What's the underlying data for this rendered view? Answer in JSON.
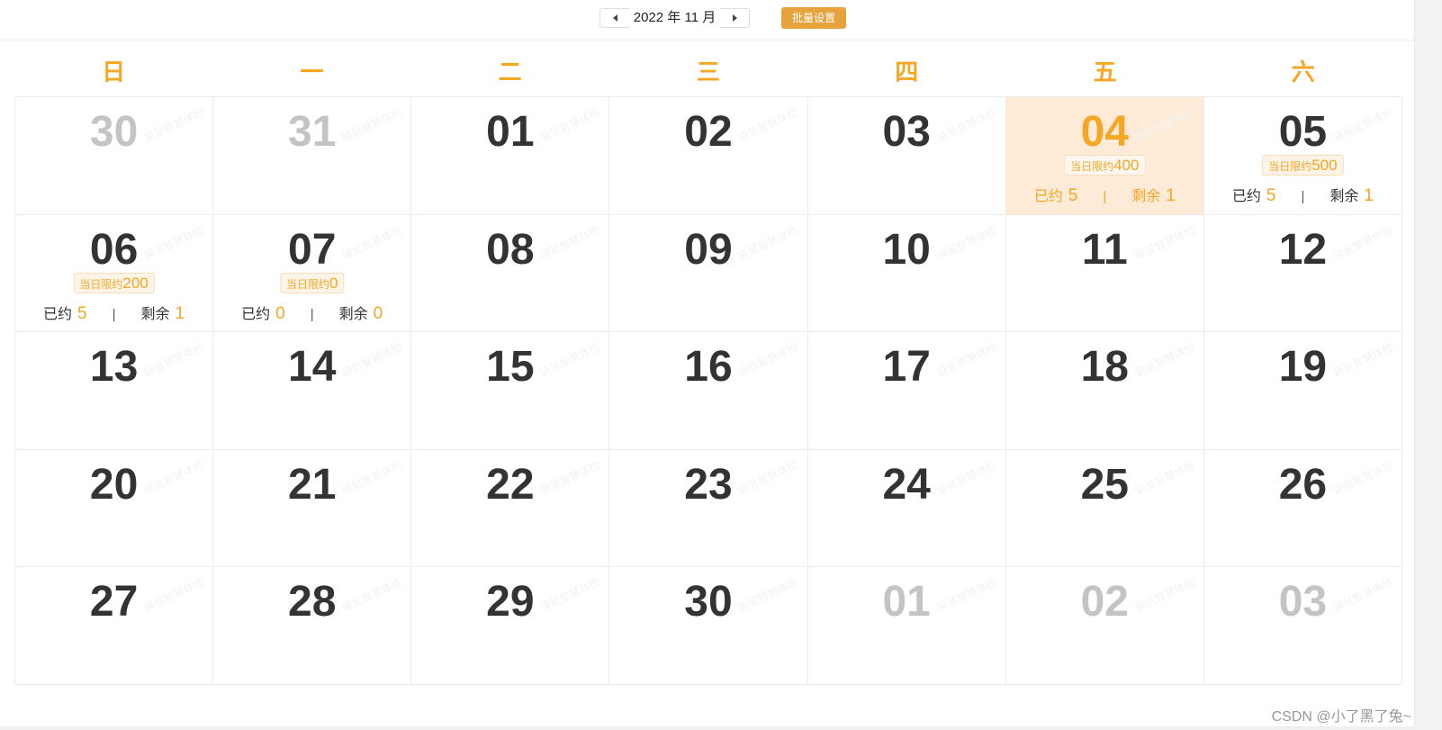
{
  "toolbar": {
    "month_label": "2022 年 11 月",
    "prev_icon": "caret-left-icon",
    "next_icon": "caret-right-icon",
    "batch_button_label": "批量设置"
  },
  "colors": {
    "accent": "#f5a623",
    "button": "#e6a23c",
    "today_bg": "#fdebd8",
    "day_text": "#333333",
    "other_month_text": "#c4c4c4"
  },
  "watermark": "袋鼠智慧体检",
  "weekdays": [
    "日",
    "一",
    "二",
    "三",
    "四",
    "五",
    "六"
  ],
  "days": [
    {
      "num": "30",
      "type": "other"
    },
    {
      "num": "31",
      "type": "other"
    },
    {
      "num": "01",
      "type": "current"
    },
    {
      "num": "02",
      "type": "current"
    },
    {
      "num": "03",
      "type": "current"
    },
    {
      "num": "04",
      "type": "today",
      "limit_label": "当日限约",
      "limit": "400",
      "booked_label": "已约",
      "booked": "5",
      "sep": "|",
      "remain_label": "剩余",
      "remain": "1"
    },
    {
      "num": "05",
      "type": "current",
      "limit_label": "当日限约",
      "limit": "500",
      "booked_label": "已约",
      "booked": "5",
      "sep": "|",
      "remain_label": "剩余",
      "remain": "1"
    },
    {
      "num": "06",
      "type": "current",
      "limit_label": "当日限约",
      "limit": "200",
      "booked_label": "已约",
      "booked": "5",
      "sep": "|",
      "remain_label": "剩余",
      "remain": "1"
    },
    {
      "num": "07",
      "type": "current",
      "limit_label": "当日限约",
      "limit": "0",
      "booked_label": "已约",
      "booked": "0",
      "sep": "|",
      "remain_label": "剩余",
      "remain": "0"
    },
    {
      "num": "08",
      "type": "current"
    },
    {
      "num": "09",
      "type": "current"
    },
    {
      "num": "10",
      "type": "current"
    },
    {
      "num": "11",
      "type": "current"
    },
    {
      "num": "12",
      "type": "current"
    },
    {
      "num": "13",
      "type": "current"
    },
    {
      "num": "14",
      "type": "current"
    },
    {
      "num": "15",
      "type": "current"
    },
    {
      "num": "16",
      "type": "current"
    },
    {
      "num": "17",
      "type": "current"
    },
    {
      "num": "18",
      "type": "current"
    },
    {
      "num": "19",
      "type": "current"
    },
    {
      "num": "20",
      "type": "current"
    },
    {
      "num": "21",
      "type": "current"
    },
    {
      "num": "22",
      "type": "current"
    },
    {
      "num": "23",
      "type": "current"
    },
    {
      "num": "24",
      "type": "current"
    },
    {
      "num": "25",
      "type": "current"
    },
    {
      "num": "26",
      "type": "current"
    },
    {
      "num": "27",
      "type": "current"
    },
    {
      "num": "28",
      "type": "current"
    },
    {
      "num": "29",
      "type": "current"
    },
    {
      "num": "30",
      "type": "current"
    },
    {
      "num": "01",
      "type": "other"
    },
    {
      "num": "02",
      "type": "other"
    },
    {
      "num": "03",
      "type": "other"
    }
  ],
  "footer": {
    "credit": "CSDN @小了黑了兔~"
  }
}
